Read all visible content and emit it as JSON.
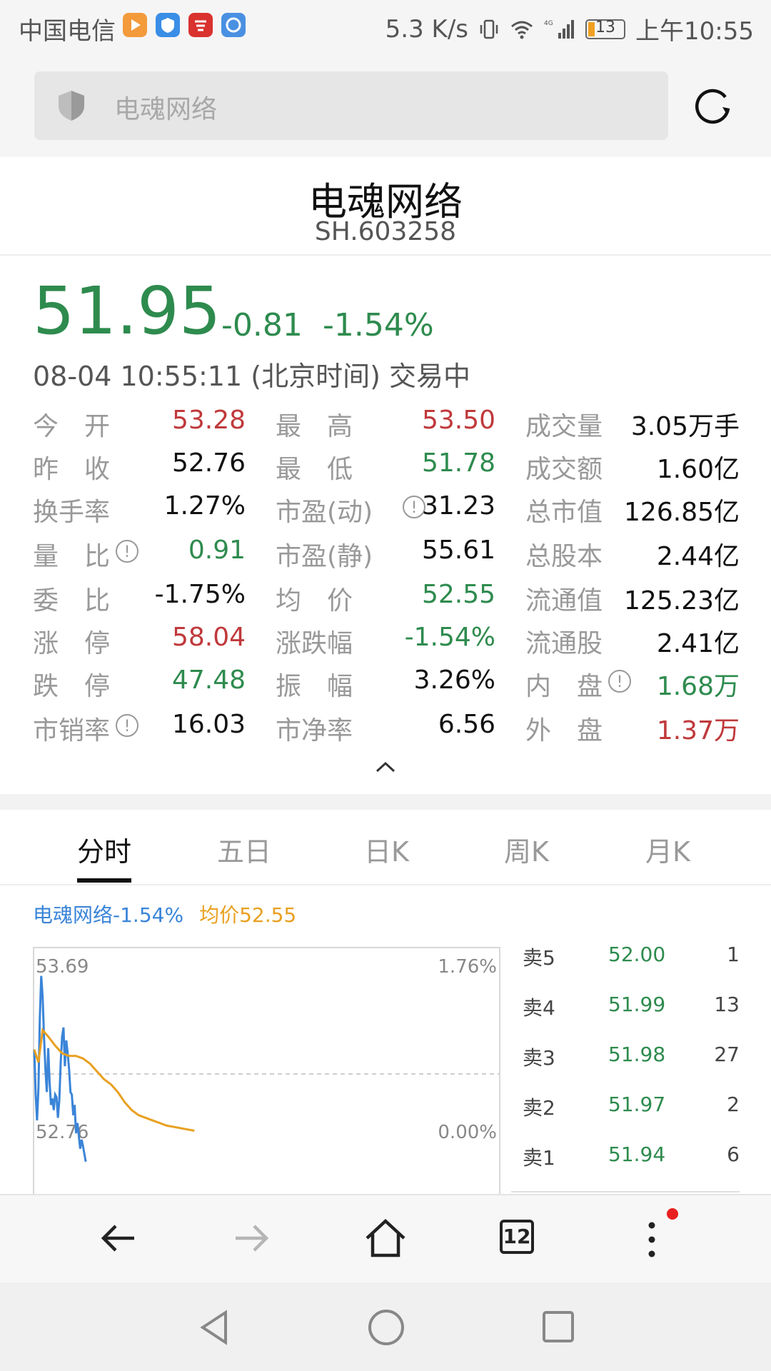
{
  "status_bar": {
    "carrier": "中国电信",
    "speed": "5.3 K/s",
    "network": "4G",
    "battery": "13",
    "time": "上午10:55"
  },
  "search": {
    "text": "电魂网络"
  },
  "stock": {
    "name": "电魂网络",
    "code": "SH.603258",
    "price": "51.95",
    "change": "-0.81",
    "change_pct": "-1.54%",
    "timestamp": "08-04 10:55:11 (北京时间) 交易中"
  },
  "stats": [
    [
      {
        "label": "今　开",
        "value": "53.28",
        "color": "red"
      },
      {
        "label": "最　高",
        "value": "53.50",
        "color": "red"
      },
      {
        "label": "成交量",
        "value": "3.05万手",
        "color": "black"
      }
    ],
    [
      {
        "label": "昨　收",
        "value": "52.76",
        "color": "black"
      },
      {
        "label": "最　低",
        "value": "51.78",
        "color": "green"
      },
      {
        "label": "成交额",
        "value": "1.60亿",
        "color": "black"
      }
    ],
    [
      {
        "label": "换手率",
        "value": "1.27%",
        "color": "black"
      },
      {
        "label": "市盈(动)",
        "value": "31.23",
        "color": "black",
        "info": true
      },
      {
        "label": "总市值",
        "value": "126.85亿",
        "color": "black"
      }
    ],
    [
      {
        "label": "量　比",
        "value": "0.91",
        "color": "green",
        "info": true
      },
      {
        "label": "市盈(静)",
        "value": "55.61",
        "color": "black"
      },
      {
        "label": "总股本",
        "value": "2.44亿",
        "color": "black"
      }
    ],
    [
      {
        "label": "委　比",
        "value": "-1.75%",
        "color": "black"
      },
      {
        "label": "均　价",
        "value": "52.55",
        "color": "green"
      },
      {
        "label": "流通值",
        "value": "125.23亿",
        "color": "black"
      }
    ],
    [
      {
        "label": "涨　停",
        "value": "58.04",
        "color": "red"
      },
      {
        "label": "涨跌幅",
        "value": "-1.54%",
        "color": "green"
      },
      {
        "label": "流通股",
        "value": "2.41亿",
        "color": "black"
      }
    ],
    [
      {
        "label": "跌　停",
        "value": "47.48",
        "color": "green"
      },
      {
        "label": "振　幅",
        "value": "3.26%",
        "color": "black"
      },
      {
        "label": "内　盘",
        "value": "1.68万",
        "color": "green",
        "info": true
      }
    ],
    [
      {
        "label": "市销率",
        "value": "16.03",
        "color": "black",
        "info": true
      },
      {
        "label": "市净率",
        "value": "6.56",
        "color": "black"
      },
      {
        "label": "外　盘",
        "value": "1.37万",
        "color": "red"
      }
    ]
  ],
  "tabs": [
    "分时",
    "五日",
    "日K",
    "周K",
    "月K"
  ],
  "active_tab": "分时",
  "legend": {
    "price_label": "电魂网络-1.54%",
    "avg_label": "均价52.55"
  },
  "chart_data": {
    "type": "line",
    "y_top_label": "53.69",
    "y_top_pct": "1.76%",
    "y_mid_label": "52.76",
    "y_mid_pct": "0.00%",
    "ylim": [
      51.83,
      53.69
    ],
    "series": [
      {
        "name": "电魂网络",
        "color": "#3a84d8",
        "x": [
          0,
          1,
          2,
          3,
          4,
          5,
          6,
          7,
          8,
          9,
          10,
          11,
          12,
          13,
          14,
          15,
          16,
          17,
          18,
          19,
          20,
          21,
          22,
          23,
          24,
          25,
          26,
          27,
          28,
          29,
          30,
          31,
          32,
          33,
          34,
          35,
          36,
          37
        ],
        "values": [
          52.95,
          52.6,
          52.4,
          52.65,
          53.2,
          53.52,
          53.36,
          53.05,
          52.8,
          52.62,
          52.96,
          52.7,
          52.52,
          52.57,
          52.48,
          52.6,
          52.58,
          52.42,
          52.56,
          52.85,
          53.05,
          53.12,
          52.82,
          53.02,
          52.92,
          52.8,
          52.62,
          52.6,
          52.44,
          52.52,
          52.3,
          52.38,
          52.28,
          52.18,
          52.25,
          52.2,
          52.14,
          52.08
        ]
      },
      {
        "name": "均价",
        "color": "#e8a020",
        "x": [
          0,
          3,
          6,
          10,
          15,
          20,
          25,
          30,
          35,
          40,
          45,
          50,
          55,
          60,
          65,
          70,
          75,
          80,
          85,
          90,
          95,
          100,
          105,
          110,
          115
        ],
        "values": [
          52.95,
          52.85,
          53.1,
          53.05,
          52.98,
          52.92,
          52.9,
          52.9,
          52.88,
          52.84,
          52.78,
          52.72,
          52.68,
          52.62,
          52.54,
          52.48,
          52.44,
          52.42,
          52.4,
          52.38,
          52.36,
          52.35,
          52.34,
          52.33,
          52.32
        ]
      }
    ]
  },
  "order_book": [
    {
      "label": "卖5",
      "price": "52.00",
      "volume": "1"
    },
    {
      "label": "卖4",
      "price": "51.99",
      "volume": "13"
    },
    {
      "label": "卖3",
      "price": "51.98",
      "volume": "27"
    },
    {
      "label": "卖2",
      "price": "51.97",
      "volume": "2"
    },
    {
      "label": "卖1",
      "price": "51.94",
      "volume": "6"
    }
  ],
  "bottom_nav": {
    "tabs_count": "12"
  }
}
